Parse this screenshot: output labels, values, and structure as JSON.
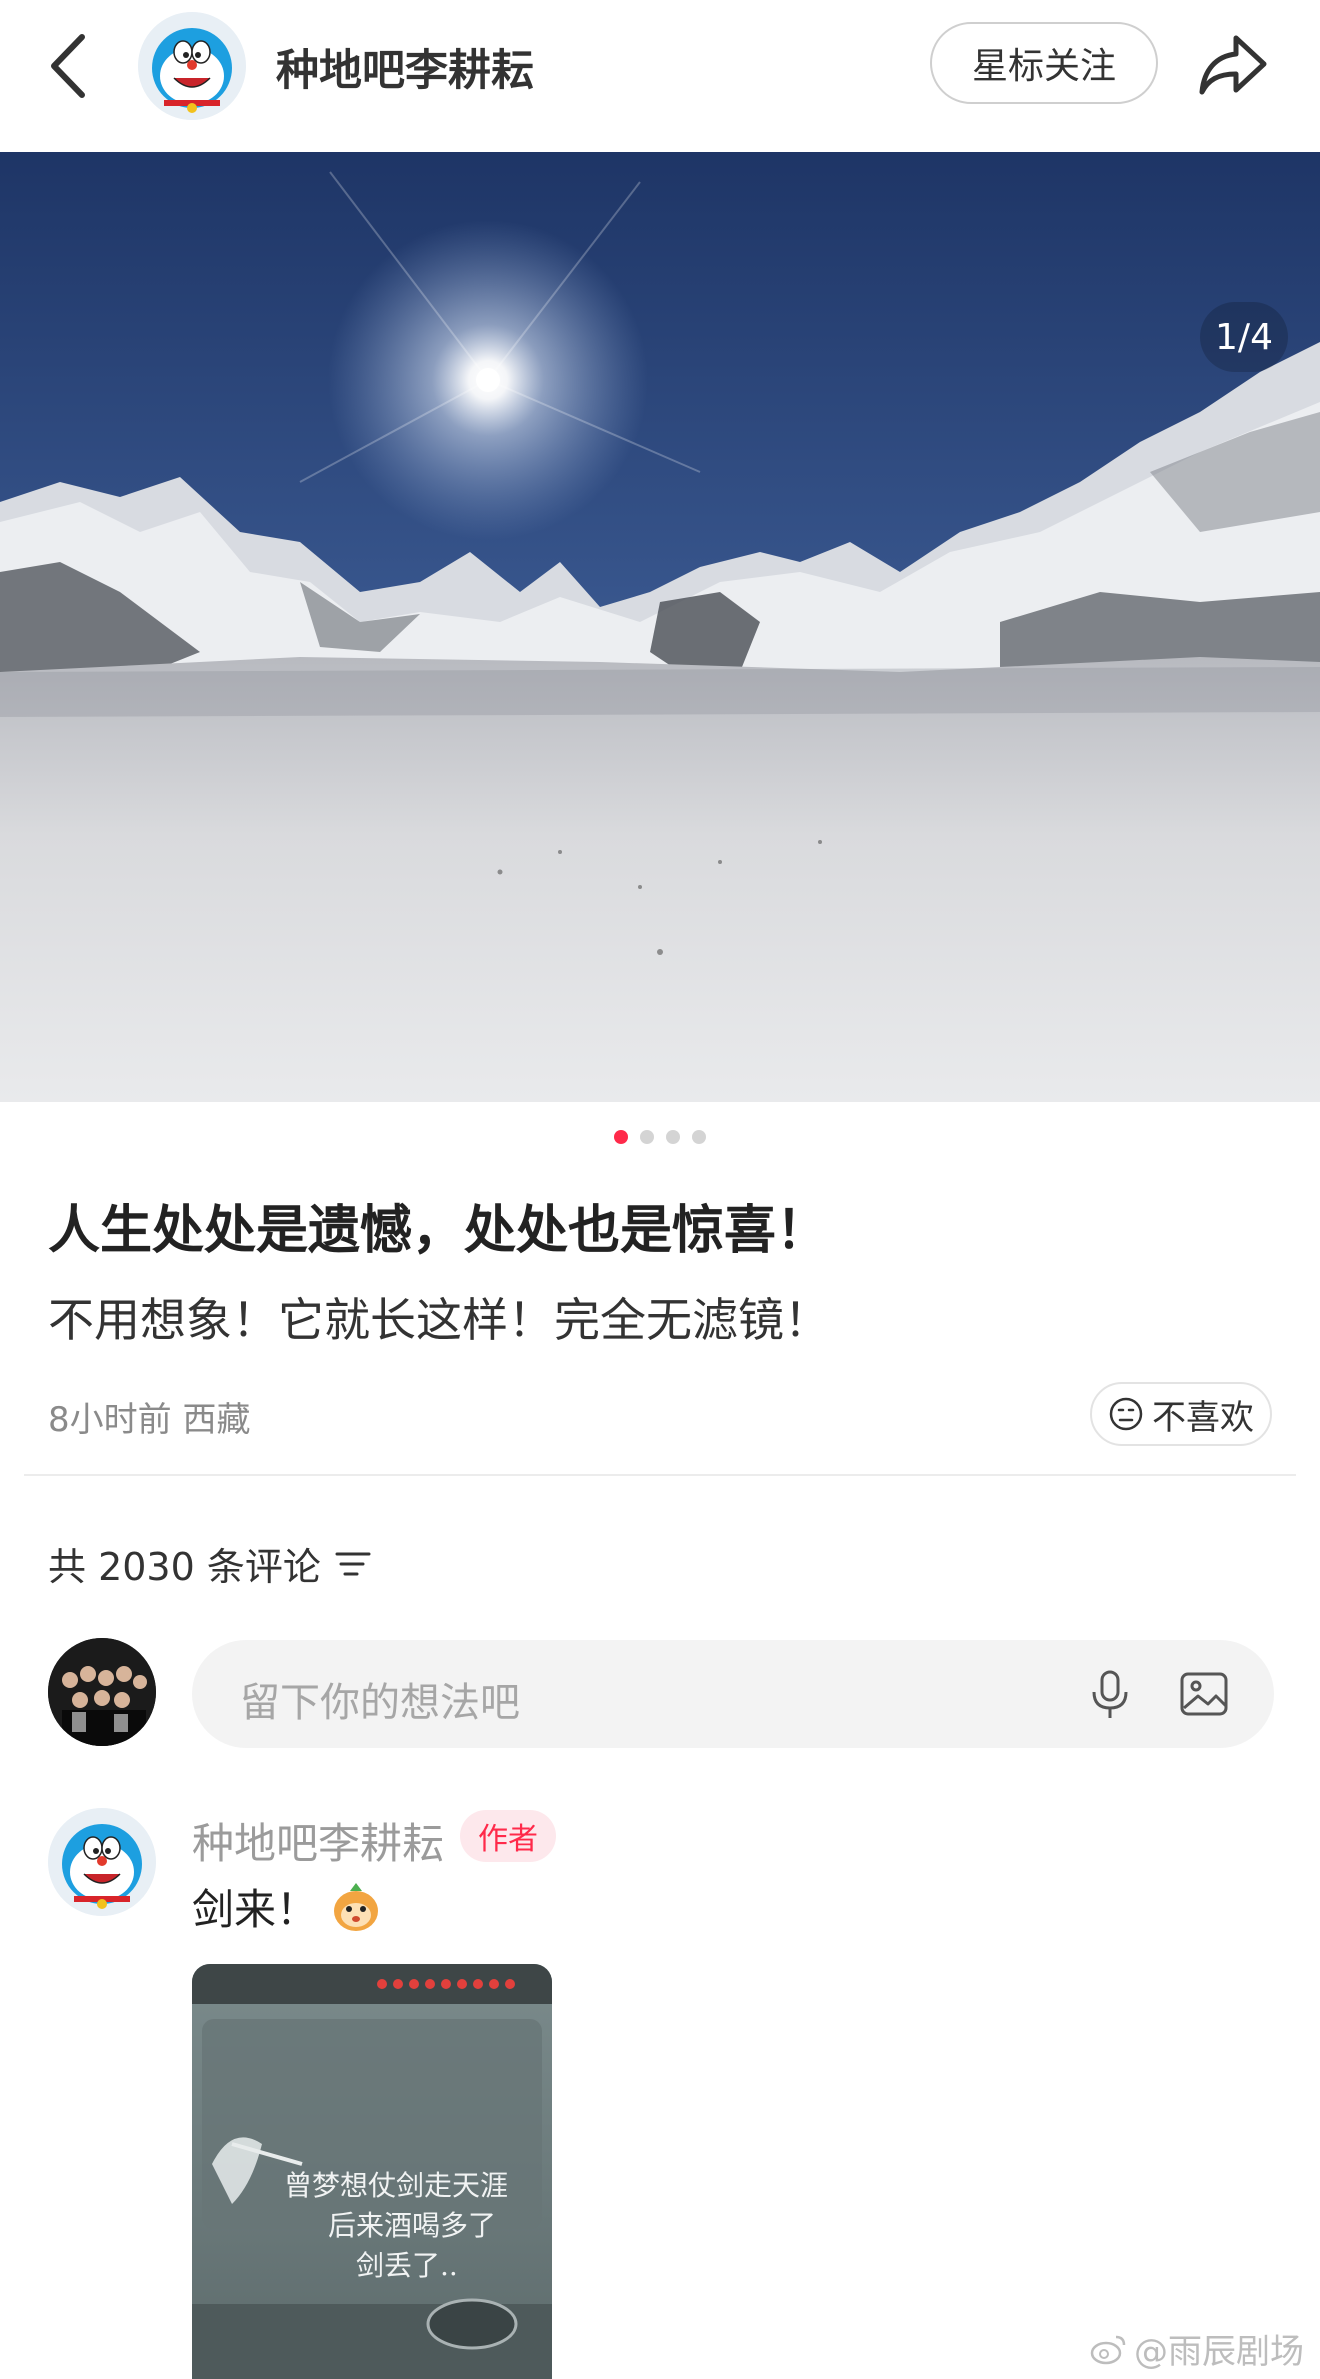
{
  "header": {
    "author_name": "种地吧李耕耘",
    "follow_label": "星标关注"
  },
  "hero": {
    "page_counter": "1/4",
    "current_page": 1,
    "total_pages": 4
  },
  "post": {
    "title": "人生处处是遗憾，处处也是惊喜！",
    "body": "不用想象！它就长这样！完全无滤镜！",
    "meta": "8小时前 西藏",
    "dislike_label": "不喜欢"
  },
  "comments": {
    "count_label": "共 2030 条评论",
    "input_placeholder": "留下你的想法吧",
    "items": [
      {
        "author": "种地吧李耕耘",
        "badge": "作者",
        "text": "剑来！",
        "image_text_lines": [
          "曾梦想仗剑走天涯",
          "后来酒喝多了",
          "剑丢了.."
        ]
      }
    ]
  },
  "watermark": "@雨辰剧场",
  "colors": {
    "accent": "#ff2a4a",
    "badge_bg": "#fde8ec",
    "placeholder": "#a6a6a6"
  },
  "icons": [
    "back-arrow-icon",
    "share-icon",
    "dislike-face-icon",
    "sort-icon",
    "mic-icon",
    "image-icon",
    "weibo-icon"
  ]
}
